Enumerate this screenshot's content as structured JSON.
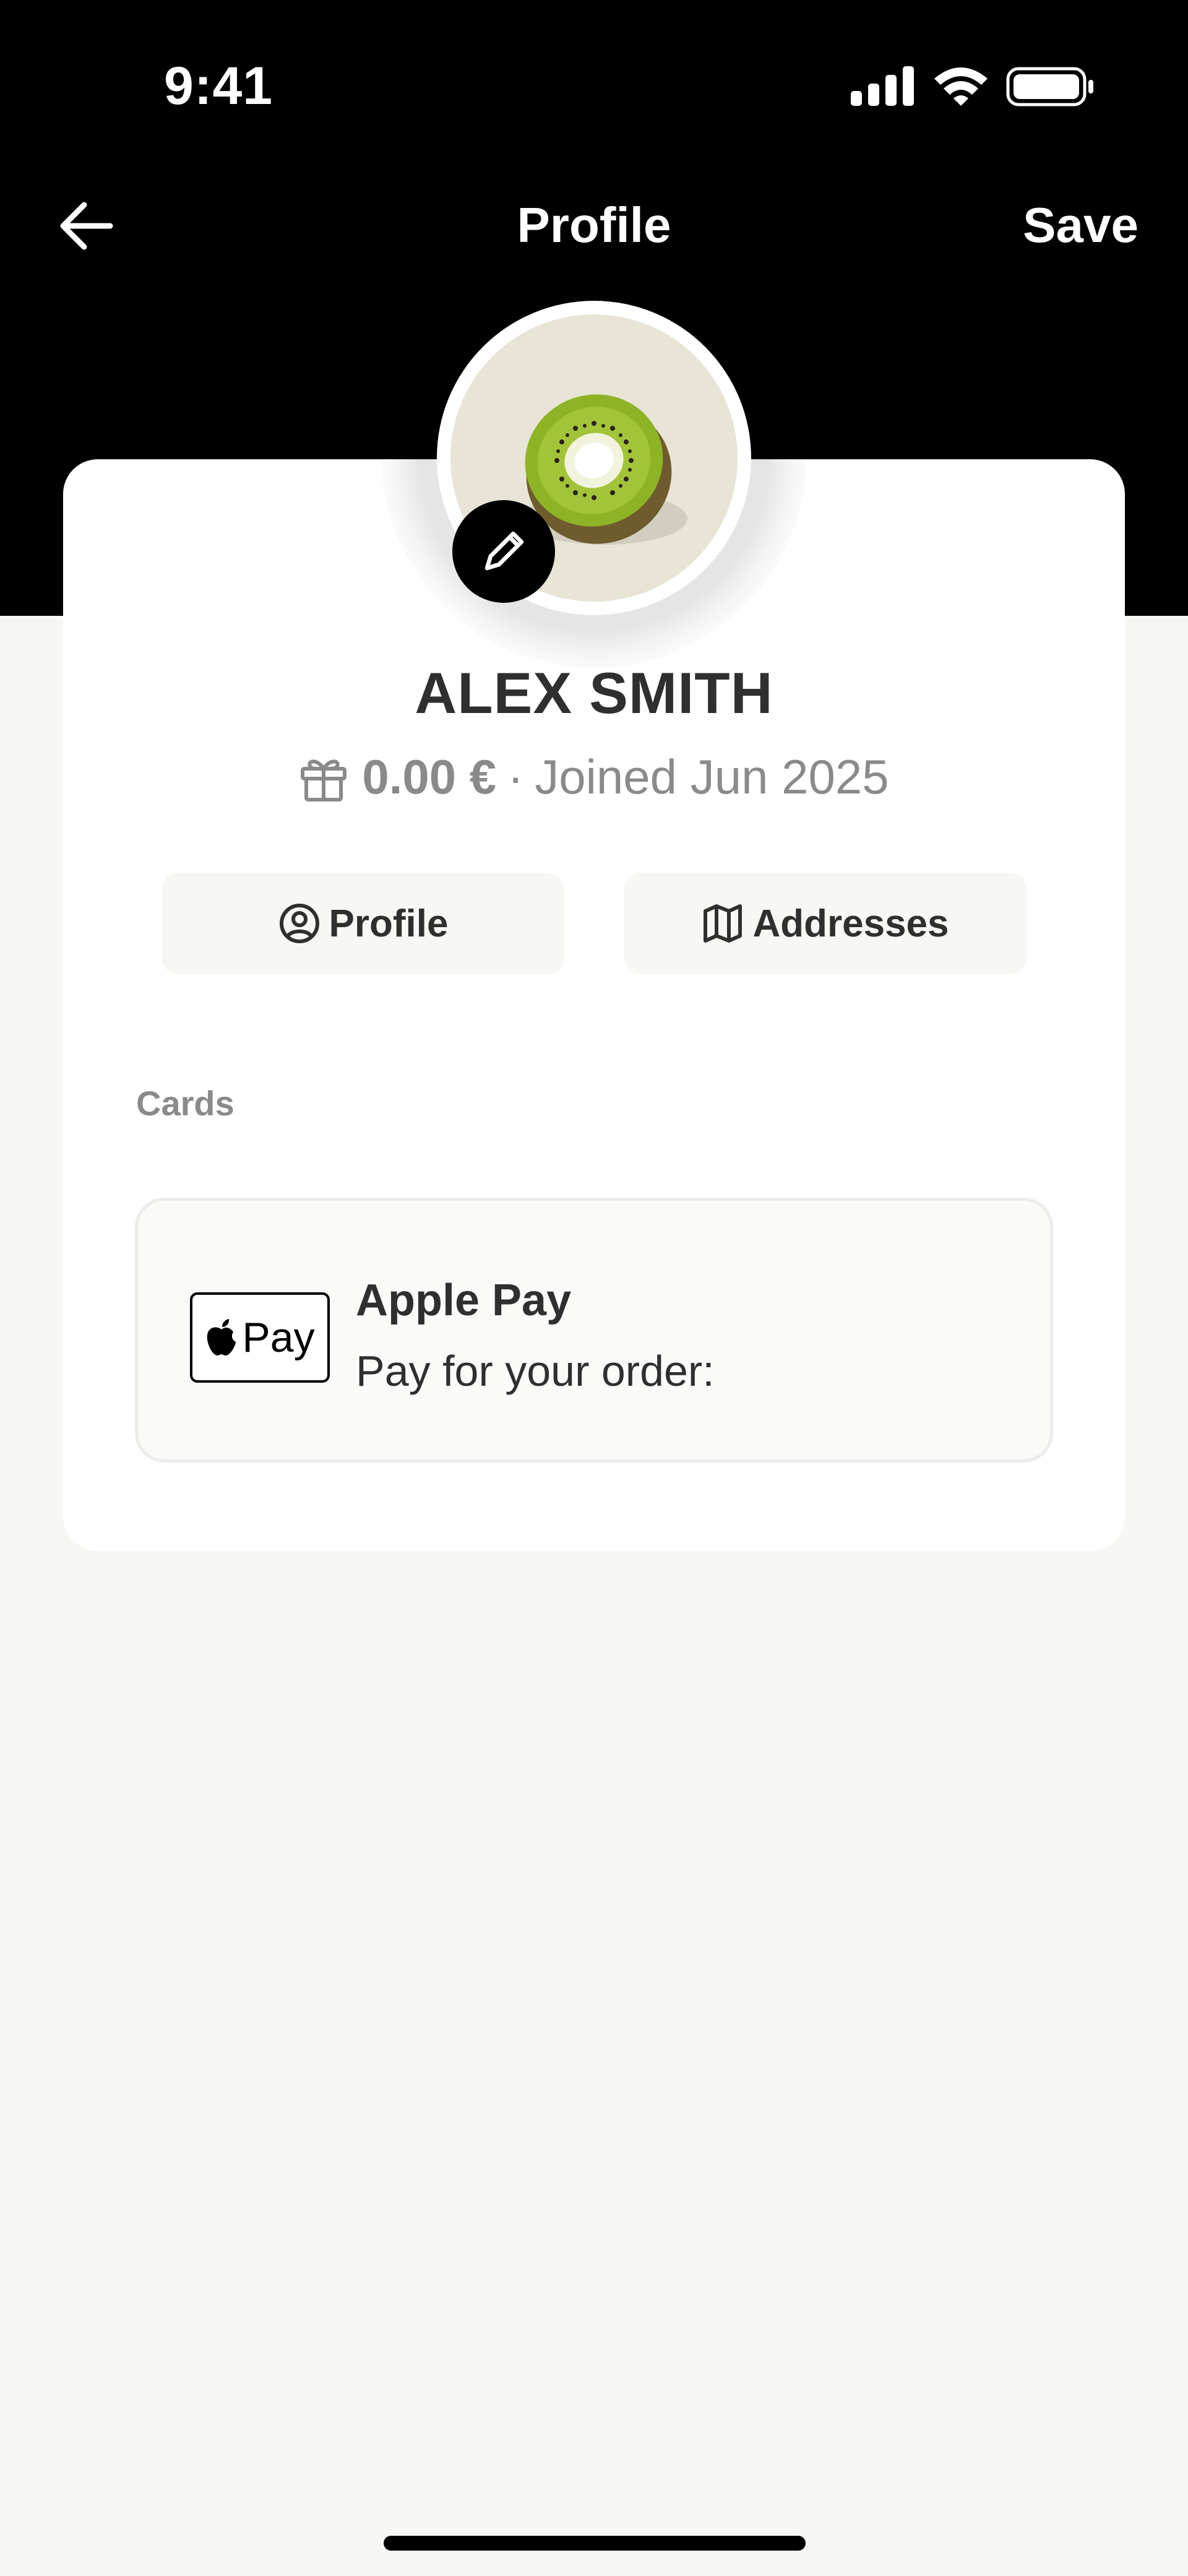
{
  "status_bar": {
    "time": "9:41",
    "icons": [
      "cellular-signal-icon",
      "wifi-icon",
      "battery-icon"
    ]
  },
  "nav": {
    "back_icon": "arrow-left-icon",
    "title": "Profile",
    "save_label": "Save"
  },
  "profile": {
    "avatar_image": "kiwi-avatar",
    "edit_icon": "pencil-icon",
    "name": "ALEX SMITH",
    "gift_icon": "gift-icon",
    "credit": "0.00 €",
    "separator": "·",
    "joined": "Joined Jun 2025"
  },
  "tabs": [
    {
      "label": "Profile",
      "icon": "user-circle-icon"
    },
    {
      "label": "Addresses",
      "icon": "map-icon"
    }
  ],
  "cards_section": {
    "label": "Cards",
    "items": [
      {
        "logo_text": "Pay",
        "logo_icon": "apple-icon",
        "name": "Apple Pay",
        "subtitle": "Pay for your order:"
      }
    ]
  },
  "colors": {
    "header_background": "#000000",
    "page_background": "#f7f7f3",
    "card_background": "#ffffff",
    "text_primary": "#2f2f2f",
    "text_secondary": "#8a8a8a"
  }
}
